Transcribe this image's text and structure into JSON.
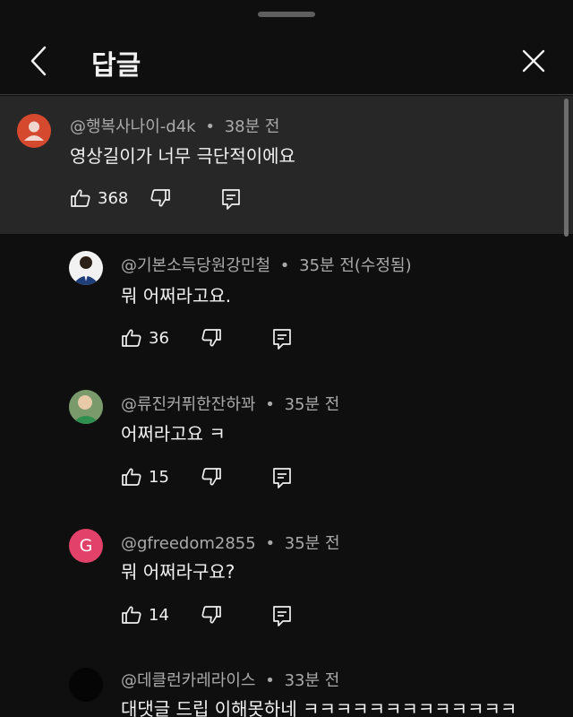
{
  "header": {
    "title": "답글"
  },
  "parent_comment": {
    "author": "@행복사나이-d4k",
    "time": "38분 전",
    "text": "영상길이가 너무 극단적이에요",
    "likes": "368"
  },
  "replies": [
    {
      "author": "@기본소득당원강민철",
      "time": "35분 전(수정됨)",
      "text": "뭐 어쩌라고요.",
      "likes": "36"
    },
    {
      "author": "@류진커퓌한잔하꽈",
      "time": "35분 전",
      "text": "어쩌라고요 ㅋ",
      "likes": "15"
    },
    {
      "author": "@gfreedom2855",
      "time": "35분 전",
      "text": "뭐 어쩌라구요?",
      "likes": "14",
      "avatar_letter": "G"
    },
    {
      "author": "@데클런카레라이스",
      "time": "33분 전",
      "text": "대댓글 드립 이해못하네 ㅋㅋㅋㅋㅋㅋㅋㅋㅋㅋㅋㅋㅋ"
    }
  ],
  "meta_separator": "•",
  "colors": {
    "background": "#0f0f0f",
    "highlight": "#272727",
    "secondary_text": "#aaaaaa",
    "avatar_g": "#e2416a",
    "avatar_default": "#d5492f"
  }
}
